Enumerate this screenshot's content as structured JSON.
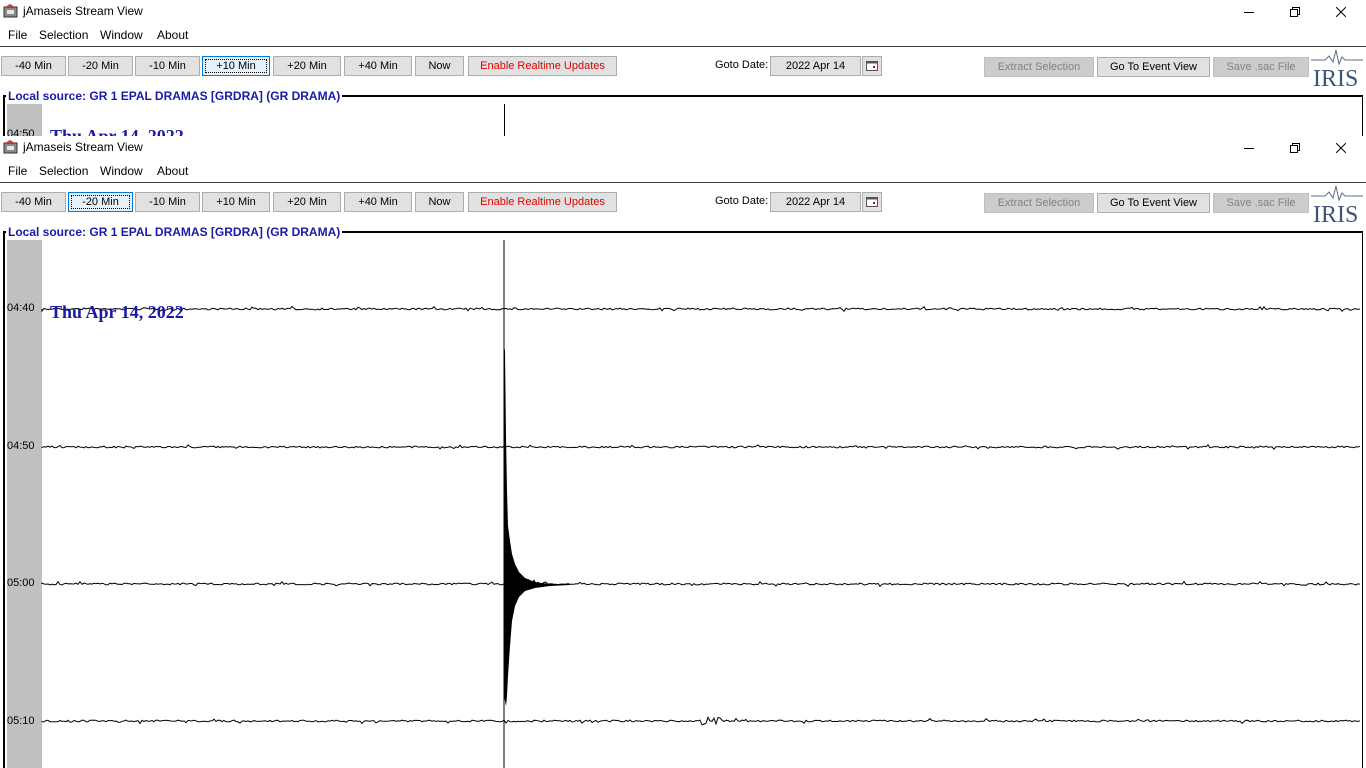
{
  "title": "jAmaseis Stream View",
  "menu": [
    "File",
    "Selection",
    "Window",
    "About"
  ],
  "nav_buttons": [
    "-40 Min",
    "-20 Min",
    "-10 Min",
    "+10 Min",
    "+20 Min",
    "+40 Min",
    "Now"
  ],
  "realtime_label": "Enable Realtime Updates",
  "goto_label": "Goto Date:",
  "goto_value": "2022 Apr 14",
  "extract_label": "Extract Selection",
  "event_view_label": "Go To Event View",
  "save_sac_label": "Save .sac File",
  "iris_logo_text": "IRIS",
  "source_label": "Local source: GR 1 EPAL DRAMAS [GRDRA] (GR DRAMA)",
  "date_stamp": "Thu Apr 14, 2022",
  "back_window": {
    "focused_button": "+10 Min",
    "visible_time_label": "04:50"
  },
  "front_window": {
    "focused_button": "-20 Min",
    "time_labels": [
      "04:40",
      "04:50",
      "05:00",
      "05:10"
    ]
  },
  "colors": {
    "source_label": "#1a1aa6",
    "realtime_button_text": "#e00000",
    "trace": "#000000",
    "time_strip": "#c0c0c0"
  },
  "icons": [
    "app-icon",
    "minimize-icon",
    "restore-icon",
    "close-icon",
    "calendar-icon"
  ]
}
